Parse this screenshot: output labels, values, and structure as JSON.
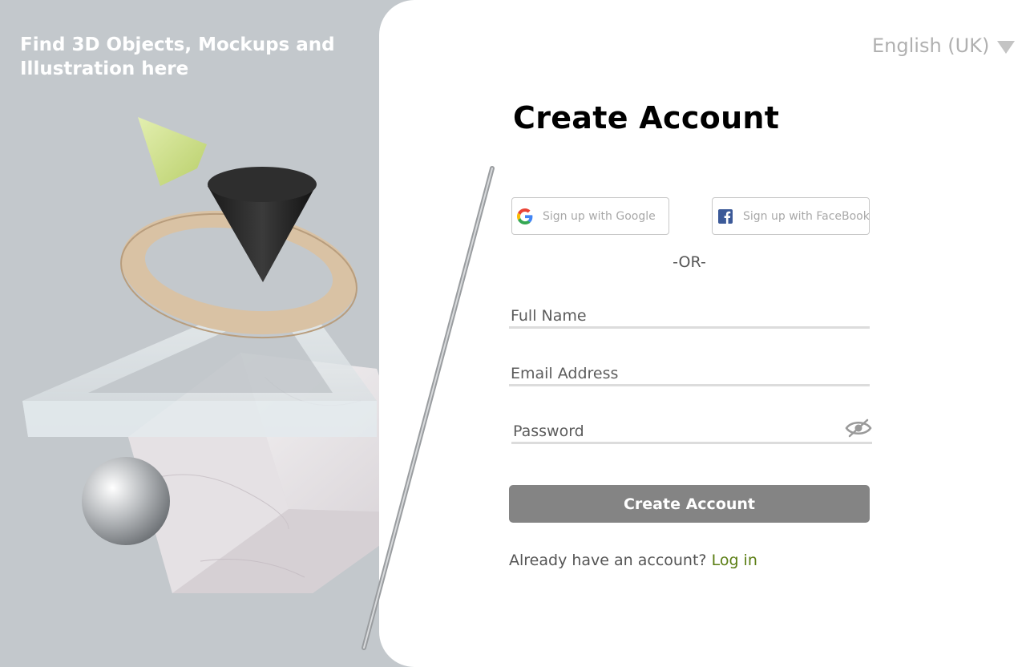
{
  "hero": {
    "tagline": "Find 3D Objects, Mockups and Illustration here"
  },
  "language": {
    "selected": "English (UK)",
    "caret_icon": "chevron-down-icon"
  },
  "form": {
    "title": "Create Account",
    "google_label": "Sign up with Google",
    "facebook_label": "Sign up with FaceBook",
    "divider": "-OR-",
    "full_name_placeholder": "Full Name",
    "email_placeholder": "Email Address",
    "password_placeholder": "Password",
    "password_toggle_icon": "eye-off-icon",
    "submit_label": "Create Account",
    "login_prompt": "Already have an account?",
    "login_link": "Log in"
  },
  "colors": {
    "hero_background": "#c3c8cc",
    "button": "#848484",
    "link": "#5a7d12",
    "cone_green": "#cfe08e"
  }
}
